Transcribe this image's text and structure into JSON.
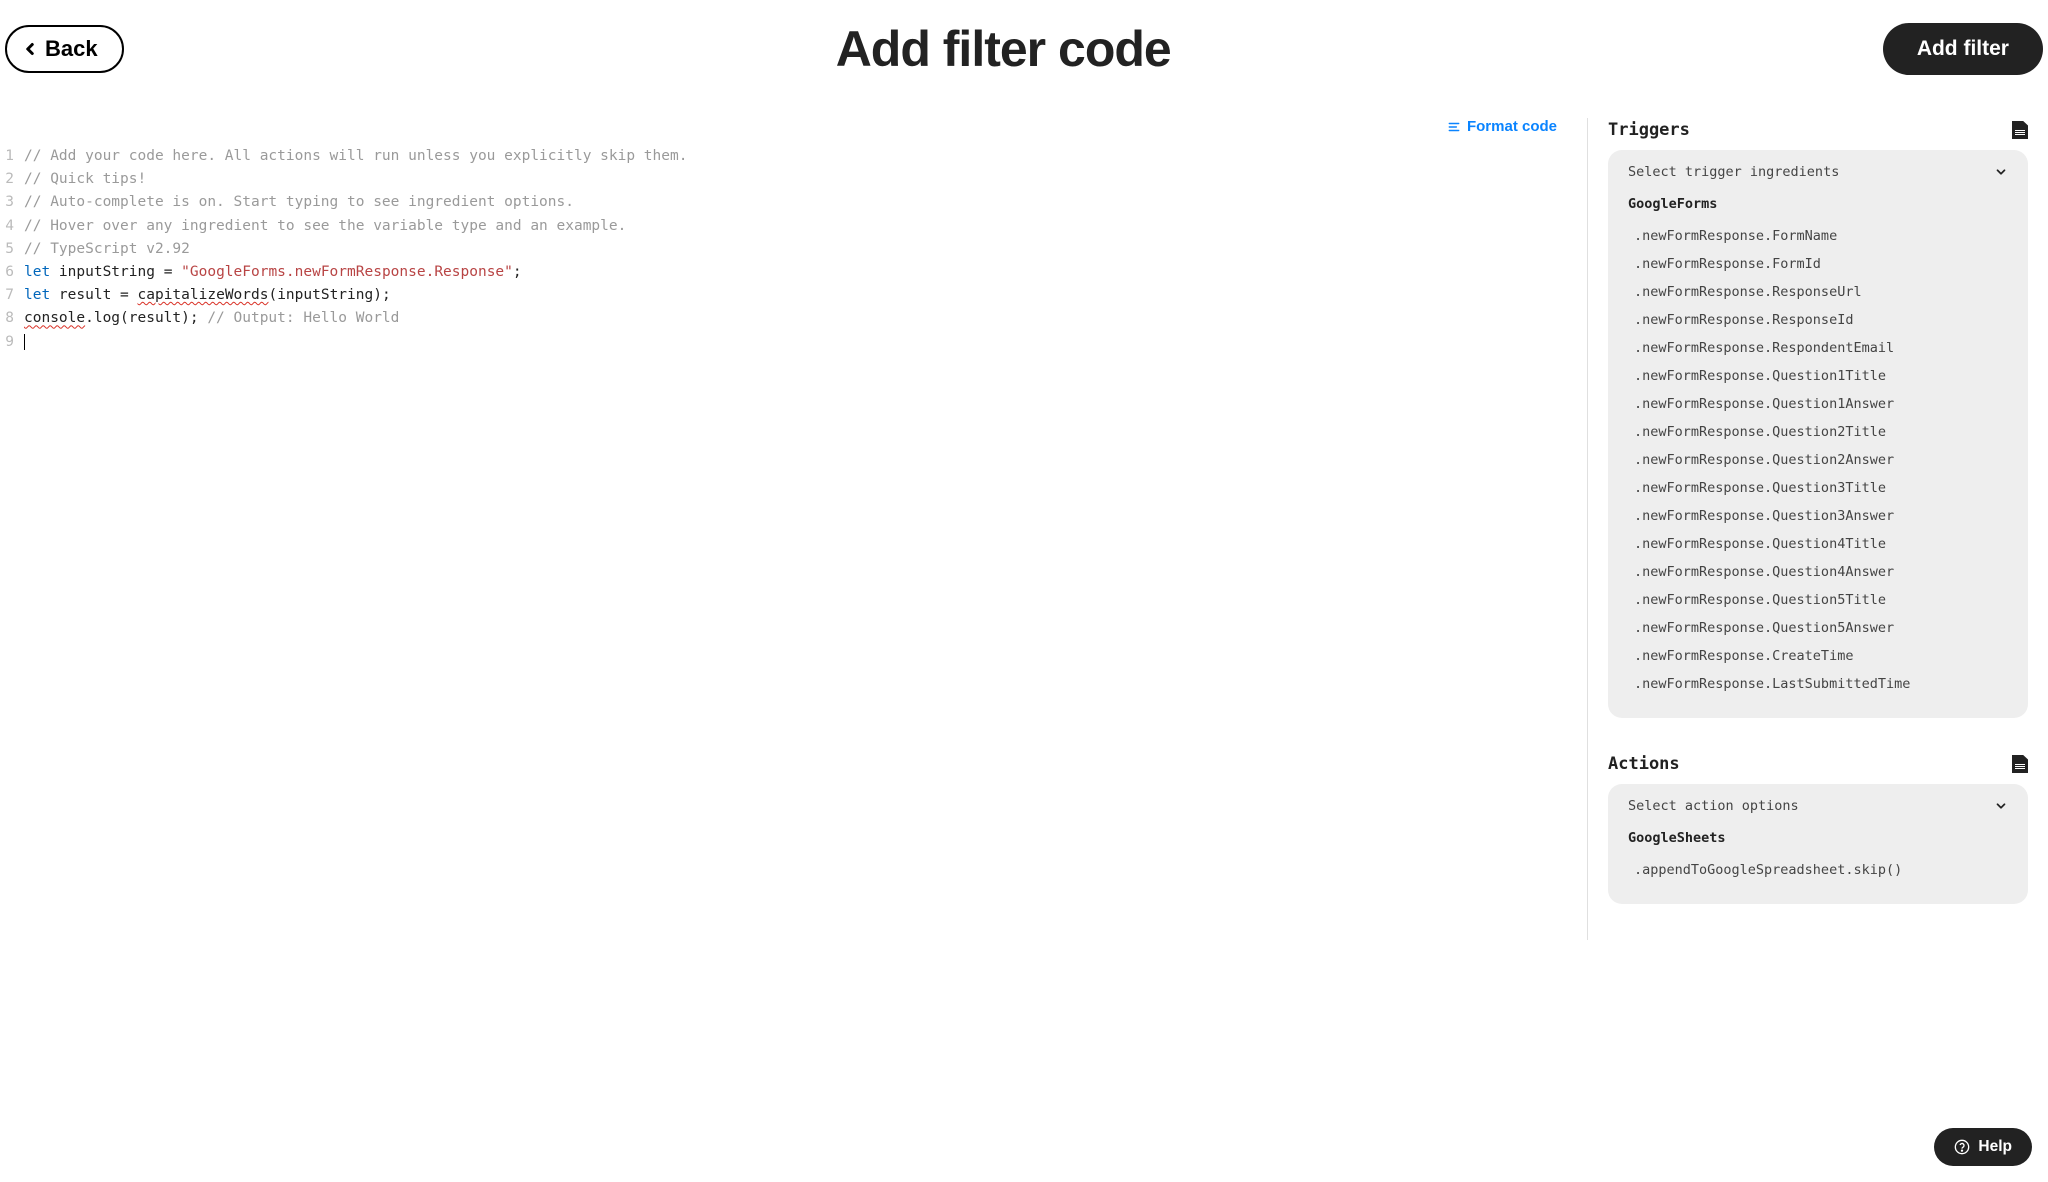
{
  "header": {
    "back_label": "Back",
    "title": "Add filter code",
    "add_filter_label": "Add filter"
  },
  "editor": {
    "format_label": "Format code",
    "lines": [
      {
        "n": 1,
        "tokens": [
          {
            "t": "// Add your code here. All actions will run unless you explicitly skip them.",
            "c": "comment"
          }
        ]
      },
      {
        "n": 2,
        "tokens": [
          {
            "t": "// Quick tips!",
            "c": "comment"
          }
        ]
      },
      {
        "n": 3,
        "tokens": [
          {
            "t": "// Auto-complete is on. Start typing to see ingredient options.",
            "c": "comment"
          }
        ]
      },
      {
        "n": 4,
        "tokens": [
          {
            "t": "// Hover over any ingredient to see the variable type and an example.",
            "c": "comment"
          }
        ]
      },
      {
        "n": 5,
        "tokens": [
          {
            "t": "// TypeScript v2.92",
            "c": "comment"
          }
        ]
      },
      {
        "n": 6,
        "tokens": [
          {
            "t": "let",
            "c": "keyword"
          },
          {
            "t": " inputString = ",
            "c": "plain"
          },
          {
            "t": "\"GoogleForms.newFormResponse.Response\"",
            "c": "string"
          },
          {
            "t": ";",
            "c": "plain"
          }
        ]
      },
      {
        "n": 7,
        "tokens": [
          {
            "t": "let",
            "c": "keyword"
          },
          {
            "t": " result = ",
            "c": "plain"
          },
          {
            "t": "capitalizeWords",
            "c": "plain",
            "sq": true
          },
          {
            "t": "(inputString);",
            "c": "plain"
          }
        ]
      },
      {
        "n": 8,
        "tokens": [
          {
            "t": "console",
            "c": "plain",
            "sq": true
          },
          {
            "t": ".log(result); ",
            "c": "plain"
          },
          {
            "t": "// Output: Hello World",
            "c": "comment"
          }
        ]
      },
      {
        "n": 9,
        "tokens": []
      }
    ]
  },
  "side": {
    "triggers_heading": "Triggers",
    "trigger_placeholder": "Select trigger ingredients",
    "trigger_group": "GoogleForms",
    "trigger_items": [
      ".newFormResponse.FormName",
      ".newFormResponse.FormId",
      ".newFormResponse.ResponseUrl",
      ".newFormResponse.ResponseId",
      ".newFormResponse.RespondentEmail",
      ".newFormResponse.Question1Title",
      ".newFormResponse.Question1Answer",
      ".newFormResponse.Question2Title",
      ".newFormResponse.Question2Answer",
      ".newFormResponse.Question3Title",
      ".newFormResponse.Question3Answer",
      ".newFormResponse.Question4Title",
      ".newFormResponse.Question4Answer",
      ".newFormResponse.Question5Title",
      ".newFormResponse.Question5Answer",
      ".newFormResponse.CreateTime",
      ".newFormResponse.LastSubmittedTime"
    ],
    "actions_heading": "Actions",
    "action_placeholder": "Select action options",
    "action_group": "GoogleSheets",
    "action_items": [
      ".appendToGoogleSpreadsheet.skip()"
    ]
  },
  "help_label": "Help"
}
